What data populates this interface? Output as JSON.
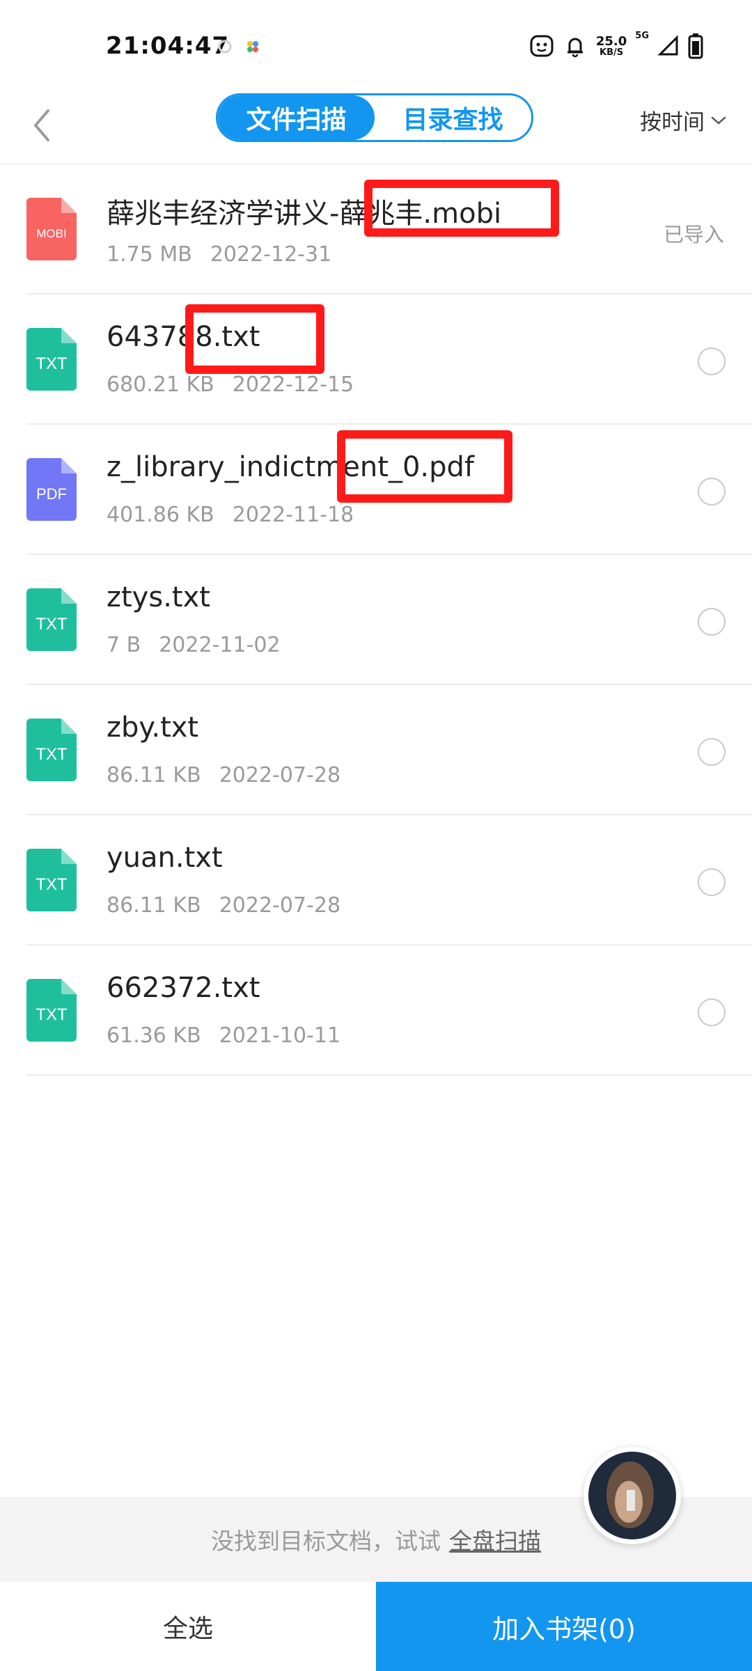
{
  "status_bar": {
    "time": "21:04:47",
    "net_speed_value": "25.0",
    "net_speed_unit": "KB/S",
    "network_type": "5G"
  },
  "topbar": {
    "tabs": [
      {
        "label": "文件扫描",
        "active": true
      },
      {
        "label": "目录查找",
        "active": false
      }
    ],
    "sort_label": "按时间"
  },
  "files": [
    {
      "name": "薛兆丰经济学讲义-薛兆丰.mobi",
      "icon_label": "MOBI",
      "icon_color": "#f76461",
      "size": "1.75 MB",
      "date": "2022-12-31",
      "status": "已导入"
    },
    {
      "name": "643788.txt",
      "icon_label": "TXT",
      "icon_color": "#1fbf9e",
      "size": "680.21 KB",
      "date": "2022-12-15",
      "status": ""
    },
    {
      "name": "z_library_indictment_0.pdf",
      "icon_label": "PDF",
      "icon_color": "#7177f5",
      "size": "401.86 KB",
      "date": "2022-11-18",
      "status": ""
    },
    {
      "name": "ztys.txt",
      "icon_label": "TXT",
      "icon_color": "#1fbf9e",
      "size": "7 B",
      "date": "2022-11-02",
      "status": ""
    },
    {
      "name": "zby.txt",
      "icon_label": "TXT",
      "icon_color": "#1fbf9e",
      "size": "86.11 KB",
      "date": "2022-07-28",
      "status": ""
    },
    {
      "name": "yuan.txt",
      "icon_label": "TXT",
      "icon_color": "#1fbf9e",
      "size": "86.11 KB",
      "date": "2022-07-28",
      "status": ""
    },
    {
      "name": "662372.txt",
      "icon_label": "TXT",
      "icon_color": "#1fbf9e",
      "size": "61.36 KB",
      "date": "2021-10-11",
      "status": ""
    }
  ],
  "hint": {
    "text": "没找到目标文档，试试",
    "link": "全盘扫描"
  },
  "bottom": {
    "select_all": "全选",
    "add_to_shelf": "加入书架(0)"
  },
  "colors": {
    "accent": "#1296f0",
    "redaction": "#ff1a1a"
  }
}
